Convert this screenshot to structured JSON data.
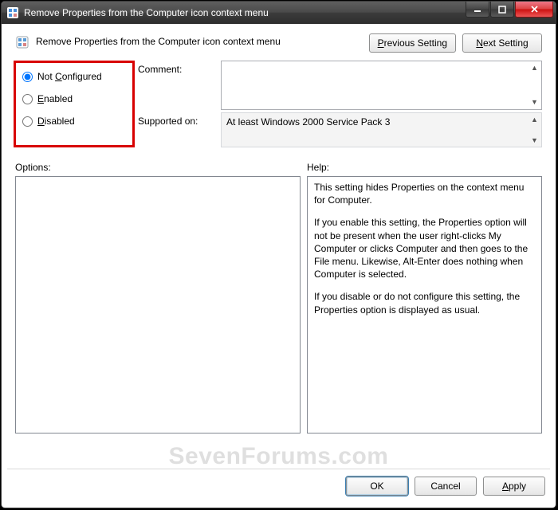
{
  "window": {
    "title": "Remove Properties from the Computer icon context menu"
  },
  "header": {
    "policy_title": "Remove Properties from the Computer icon context menu",
    "prev_btn_pre": "",
    "prev_btn_u": "P",
    "prev_btn_post": "revious Setting",
    "next_btn_pre": "",
    "next_btn_u": "N",
    "next_btn_post": "ext Setting"
  },
  "state": {
    "not_configured_pre": "Not ",
    "not_configured_u": "C",
    "not_configured_post": "onfigured",
    "enabled_u": "E",
    "enabled_post": "nabled",
    "disabled_u": "D",
    "disabled_post": "isabled",
    "selected": "not_configured"
  },
  "fields": {
    "comment_label": "Comment:",
    "comment_value": "",
    "supported_label": "Supported on:",
    "supported_value": "At least Windows 2000 Service Pack 3"
  },
  "sections": {
    "options_label": "Options:",
    "help_label": "Help:"
  },
  "help": {
    "p1": "This setting hides Properties on the context menu for Computer.",
    "p2": "If you enable this setting, the Properties option will not be present when the user right-clicks My Computer or clicks Computer and then goes to the File menu.  Likewise, Alt-Enter does nothing when Computer is selected.",
    "p3": "If you disable or do not configure this setting, the Properties option is displayed as usual."
  },
  "footer": {
    "ok": "OK",
    "cancel": "Cancel",
    "apply_u": "A",
    "apply_post": "pply"
  },
  "watermark": "SevenForums.com"
}
